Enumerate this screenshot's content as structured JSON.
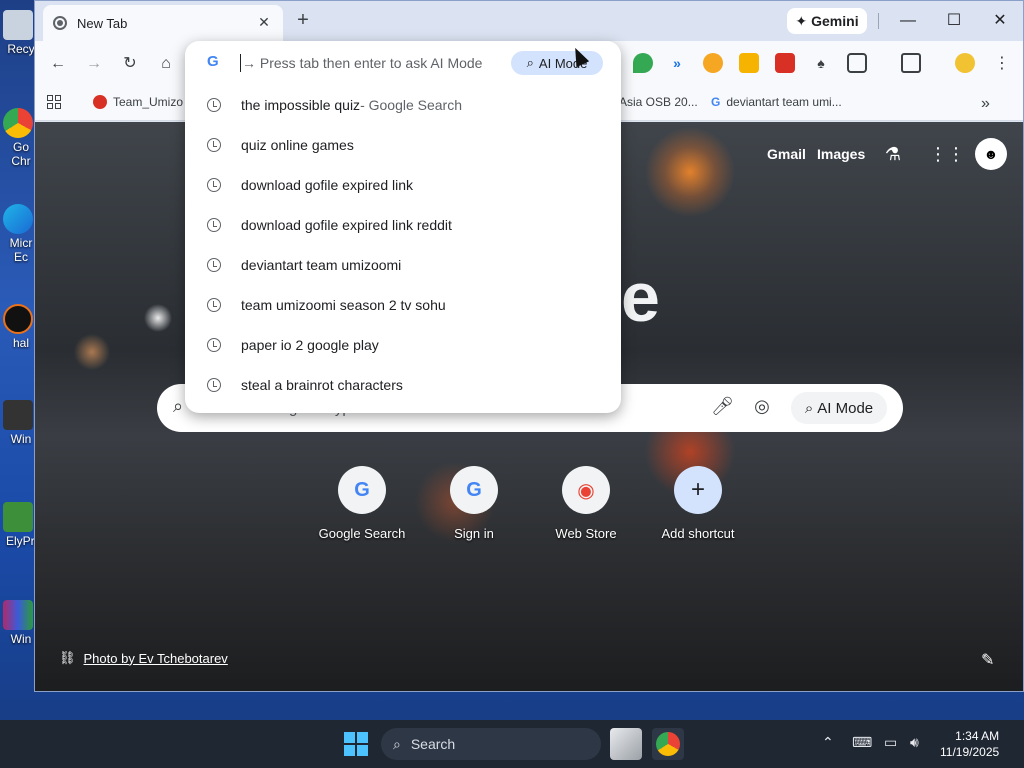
{
  "desktop": {
    "icons": [
      {
        "label": "Recy"
      },
      {
        "label": "Go Chr"
      },
      {
        "label": "Micr Ec"
      },
      {
        "label": "hal"
      },
      {
        "label": "Win"
      },
      {
        "label": "ElyPri"
      },
      {
        "label": "Win"
      }
    ]
  },
  "browser": {
    "tab": {
      "title": "New Tab",
      "close": "✕"
    },
    "new_tab": "+",
    "gemini": {
      "label": "Gemini",
      "icon": "✦"
    },
    "window_controls": {
      "minimize": "—",
      "maximize": "☐",
      "close": "✕"
    },
    "toolbar": {
      "back": "←",
      "forward": "→",
      "reload": "↻",
      "home": "⌂",
      "menu": "⋮"
    },
    "bookmarks": [
      {
        "label": "Team_Umizo",
        "color": "#d93025"
      },
      {
        "label": "Asia OSB 20...",
        "color": ""
      },
      {
        "label": "deviantart team umi...",
        "color": "#4285f4"
      }
    ],
    "bookmarks_overflow": "»"
  },
  "omnibox": {
    "g_icon": "G",
    "hint_arrow": "→",
    "hint": "Press tab then enter to ask AI Mode",
    "ai_mode": "AI Mode",
    "suggestions": [
      {
        "text": "the impossible quiz",
        "sub": " - Google Search"
      },
      {
        "text": "quiz online games",
        "sub": ""
      },
      {
        "text": "download gofile expired link",
        "sub": ""
      },
      {
        "text": "download gofile expired link reddit",
        "sub": ""
      },
      {
        "text": "deviantart team umizoomi",
        "sub": ""
      },
      {
        "text": "team umizoomi season 2 tv sohu",
        "sub": ""
      },
      {
        "text": "paper io 2 google play",
        "sub": ""
      },
      {
        "text": "steal a brainrot characters",
        "sub": ""
      }
    ]
  },
  "ntp": {
    "links": {
      "gmail": "Gmail",
      "images": "Images"
    },
    "logo_fragment": "e",
    "search": {
      "placeholder": "Search Google or type a URL",
      "ai_mode": "AI Mode"
    },
    "shortcuts": [
      {
        "label": "Google Search",
        "glyph": "G"
      },
      {
        "label": "Sign in",
        "glyph": "G"
      },
      {
        "label": "Web Store",
        "glyph": "◉"
      },
      {
        "label": "Add shortcut",
        "glyph": "+"
      }
    ],
    "photo_credit": "Photo by Ev Tchebotarev"
  },
  "taskbar": {
    "search": "Search",
    "time": "1:34 AM",
    "date": "11/19/2025"
  },
  "colors": {
    "accent": "#4285f4",
    "ai_chip": "#d3e3fd"
  }
}
